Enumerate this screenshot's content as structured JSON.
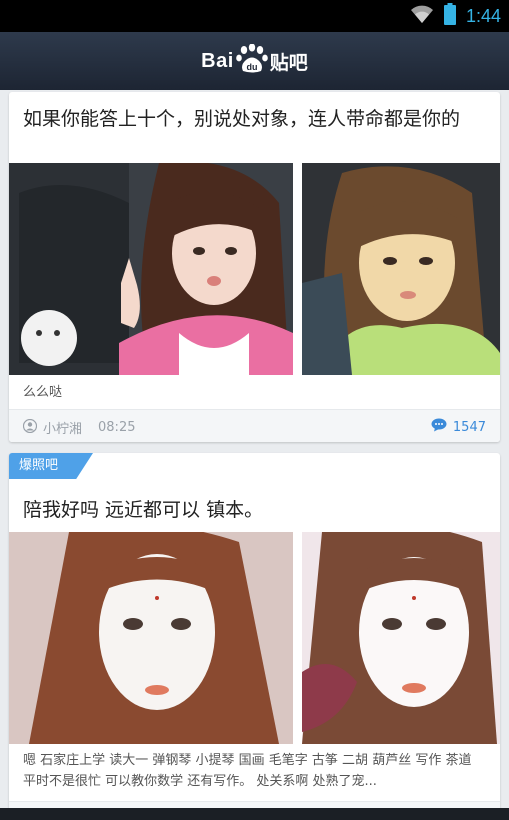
{
  "status_bar": {
    "time": "1:44"
  },
  "app_bar": {
    "logo_text_left": "Bai",
    "logo_text_right": "贴吧"
  },
  "posts": [
    {
      "forum_tag": "",
      "title": "如果你能答上十个，别说处对象，连人带命都是你的",
      "excerpt": "么么哒",
      "username": "小柠湘",
      "time": "08:25",
      "comment_count": "1547"
    },
    {
      "forum_tag": "爆照吧",
      "title": "陪我好吗 远近都可以  镇本。",
      "excerpt": "嗯 石家庄上学 读大一 弹钢琴 小提琴 国画 毛笔字 古筝 二胡 葫芦丝 写作 茶道 平时不是很忙 可以教你数学 还有写作。 处关系啊 处熟了宠...",
      "username": "",
      "time": "",
      "comment_count": ""
    }
  ],
  "colors": {
    "accent": "#35b3e5",
    "tag_blue": "#4fa1e8",
    "comment_blue": "#3b8ad9"
  }
}
